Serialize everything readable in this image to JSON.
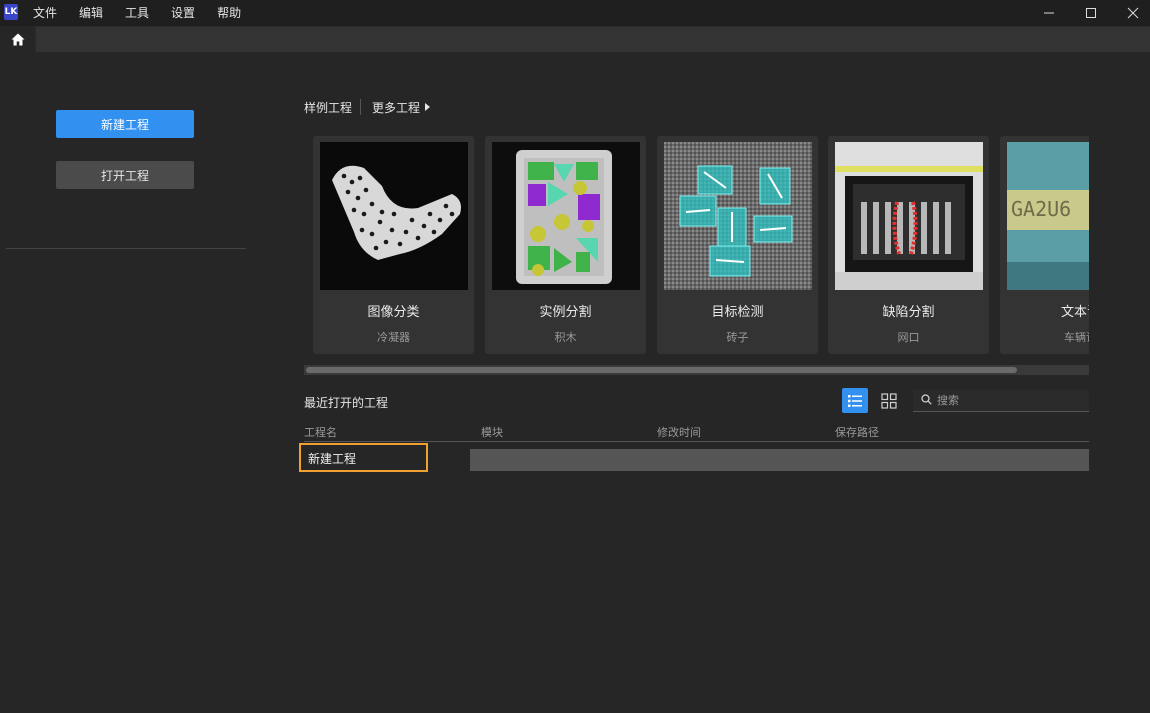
{
  "app": {
    "logo_text": "LK"
  },
  "menu": [
    "文件",
    "编辑",
    "工具",
    "设置",
    "帮助"
  ],
  "window_controls": [
    "minimize",
    "maximize",
    "close"
  ],
  "tabs": [
    {
      "icon": "home-icon"
    }
  ],
  "left_panel": {
    "new_project": "新建工程",
    "open_project": "打开工程"
  },
  "samples": {
    "label": "样例工程",
    "more": "更多工程",
    "cards": [
      {
        "title": "图像分类",
        "subtitle": "冷凝器"
      },
      {
        "title": "实例分割",
        "subtitle": "积木"
      },
      {
        "title": "目标检测",
        "subtitle": "砖子"
      },
      {
        "title": "缺陷分割",
        "subtitle": "网口"
      },
      {
        "title": "文本识",
        "subtitle": "车辆识"
      }
    ],
    "scroll_fraction": 0.91
  },
  "recent": {
    "title": "最近打开的工程",
    "search_placeholder": "搜索",
    "columns": [
      "工程名",
      "模块",
      "修改时间",
      "保存路径"
    ],
    "rows": [
      {
        "name": "新建工程",
        "module": "",
        "modified": "",
        "path": ""
      }
    ]
  },
  "colors": {
    "accent": "#3291f0",
    "highlight": "#f0a030",
    "background": "#262626"
  }
}
